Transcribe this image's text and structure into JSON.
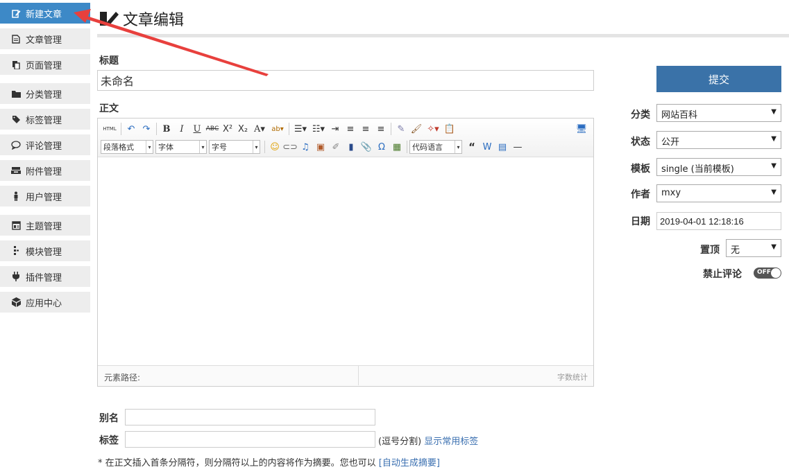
{
  "sidebar": {
    "items": [
      {
        "label": "新建文章",
        "icon": "new-post-icon",
        "active": true
      },
      {
        "label": "文章管理",
        "icon": "document-icon"
      },
      {
        "label": "页面管理",
        "icon": "pages-icon"
      },
      {
        "label": "分类管理",
        "icon": "folder-icon"
      },
      {
        "label": "标签管理",
        "icon": "tag-icon"
      },
      {
        "label": "评论管理",
        "icon": "comment-icon"
      },
      {
        "label": "附件管理",
        "icon": "attachment-icon"
      },
      {
        "label": "用户管理",
        "icon": "user-icon"
      },
      {
        "label": "主题管理",
        "icon": "theme-icon"
      },
      {
        "label": "模块管理",
        "icon": "module-icon"
      },
      {
        "label": "插件管理",
        "icon": "plugin-icon"
      },
      {
        "label": "应用中心",
        "icon": "app-center-icon"
      }
    ]
  },
  "page": {
    "title": "文章编辑",
    "icon": "edit-icon"
  },
  "form": {
    "title_label": "标题",
    "title_value": "未命名",
    "body_label": "正文",
    "alias_label": "别名",
    "tags_label": "标签",
    "tags_hint": "(逗号分割)",
    "tags_link": "显示常用标签",
    "note_text": "* 在正文插入首条分隔符，则分隔符以上的内容将作为摘要。您也可以",
    "note_link": "[自动生成摘要]"
  },
  "editor": {
    "combos": {
      "paragraph": "段落格式",
      "font": "字体",
      "size": "字号",
      "code": "代码语言"
    },
    "status_path": "元素路径:",
    "word_count": "字数统计",
    "html_label": "HTML"
  },
  "sidepanel": {
    "submit": "提交",
    "category_label": "分类",
    "category_value": "网站百科",
    "status_label": "状态",
    "status_value": "公开",
    "template_label": "模板",
    "template_value": "single (当前模板)",
    "author_label": "作者",
    "author_value": "mxy",
    "date_label": "日期",
    "date_value": "2019-04-01 12:18:16",
    "sticky_label": "置顶",
    "sticky_value": "无",
    "comments_label": "禁止评论",
    "comments_toggle": "OFF"
  },
  "colors": {
    "accent": "#3d89c7",
    "submit": "#3a72a8",
    "annotation_arrow": "#e8403d"
  }
}
